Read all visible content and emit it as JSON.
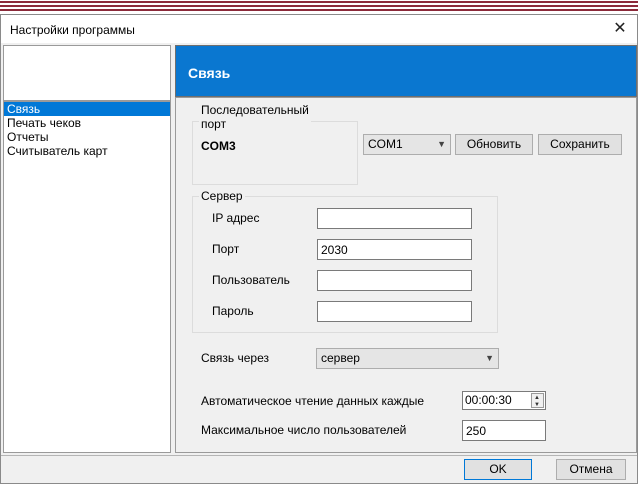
{
  "window": {
    "title": "Настройки программы"
  },
  "sidebar": {
    "items": [
      {
        "label": "Связь"
      },
      {
        "label": "Печать чеков"
      },
      {
        "label": "Отчеты"
      },
      {
        "label": "Считыватель карт"
      }
    ]
  },
  "header": {
    "title": "Связь"
  },
  "serial": {
    "group_label_line1": "Последовательный",
    "group_label_line2": "порт",
    "current_port": "COM3",
    "selected_port": "COM1",
    "refresh_label": "Обновить",
    "save_label": "Сохранить"
  },
  "server": {
    "group_label": "Сервер",
    "ip_label": "IP адрес",
    "ip_value": "",
    "port_label": "Порт",
    "port_value": "2030",
    "user_label": "Пользователь",
    "user_value": "",
    "password_label": "Пароль",
    "password_value": ""
  },
  "connection": {
    "label": "Связь через",
    "selected": "сервер"
  },
  "auto_read": {
    "label": "Автоматическое чтение данных  каждые",
    "value": "00:00:30"
  },
  "max_users": {
    "label": "Максимальное число пользователей",
    "value": "250"
  },
  "footer": {
    "ok_label": "OK",
    "cancel_label": "Отмена"
  },
  "colors": {
    "accent": "#0a77d0",
    "selection": "#0078d7",
    "stripe": "#8b2a3a"
  }
}
